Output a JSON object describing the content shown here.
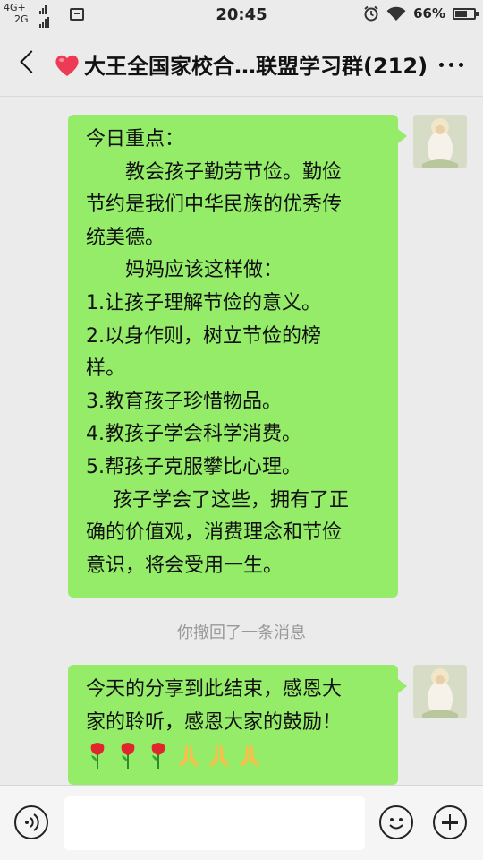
{
  "status_bar": {
    "network_top": "4G+",
    "network_bottom": "2G",
    "time": "20:45",
    "battery_percent": "66%",
    "battery_level": 0.66,
    "icons": [
      "signal-icon",
      "notification-icon",
      "alarm-icon",
      "wifi-icon",
      "battery-charging-icon"
    ]
  },
  "header": {
    "back_icon": "chevron-left-icon",
    "title_icon": "heart-icon",
    "title": "大王全国家校合…联盟学习群(212)",
    "more_icon": "more-dots-icon"
  },
  "messages": [
    {
      "sender": "self",
      "lines": [
        "今日重点：",
        "教会孩子勤劳节俭。勤俭",
        "节约是我们中华民族的优秀传",
        "统美德。",
        "妈妈应该这样做：",
        "1.让孩子理解节俭的意义。",
        "2.以身作则，树立节俭的榜",
        "样。",
        "3.教育孩子珍惜物品。",
        "4.教孩子学会科学消费。",
        "5.帮孩子克服攀比心理。",
        "孩子学会了这些，拥有了正",
        "确的价值观，消费理念和节俭",
        "意识，将会受用一生。"
      ]
    },
    {
      "sender": "system",
      "text": "你撤回了一条消息"
    },
    {
      "sender": "self",
      "lines": [
        "今天的分享到此结束，感恩大",
        "家的聆听，感恩大家的鼓励！"
      ],
      "emojis": [
        "rose-emoji",
        "rose-emoji",
        "rose-emoji",
        "pray-emoji",
        "pray-emoji",
        "pray-emoji"
      ]
    }
  ],
  "bottom_bar": {
    "voice_icon": "voice-icon",
    "input_value": "",
    "emoji_icon": "smiley-icon",
    "plus_icon": "plus-icon"
  },
  "colors": {
    "bubble_self": "#95ec69",
    "background": "#ebebeb",
    "recall_text": "#999999"
  }
}
